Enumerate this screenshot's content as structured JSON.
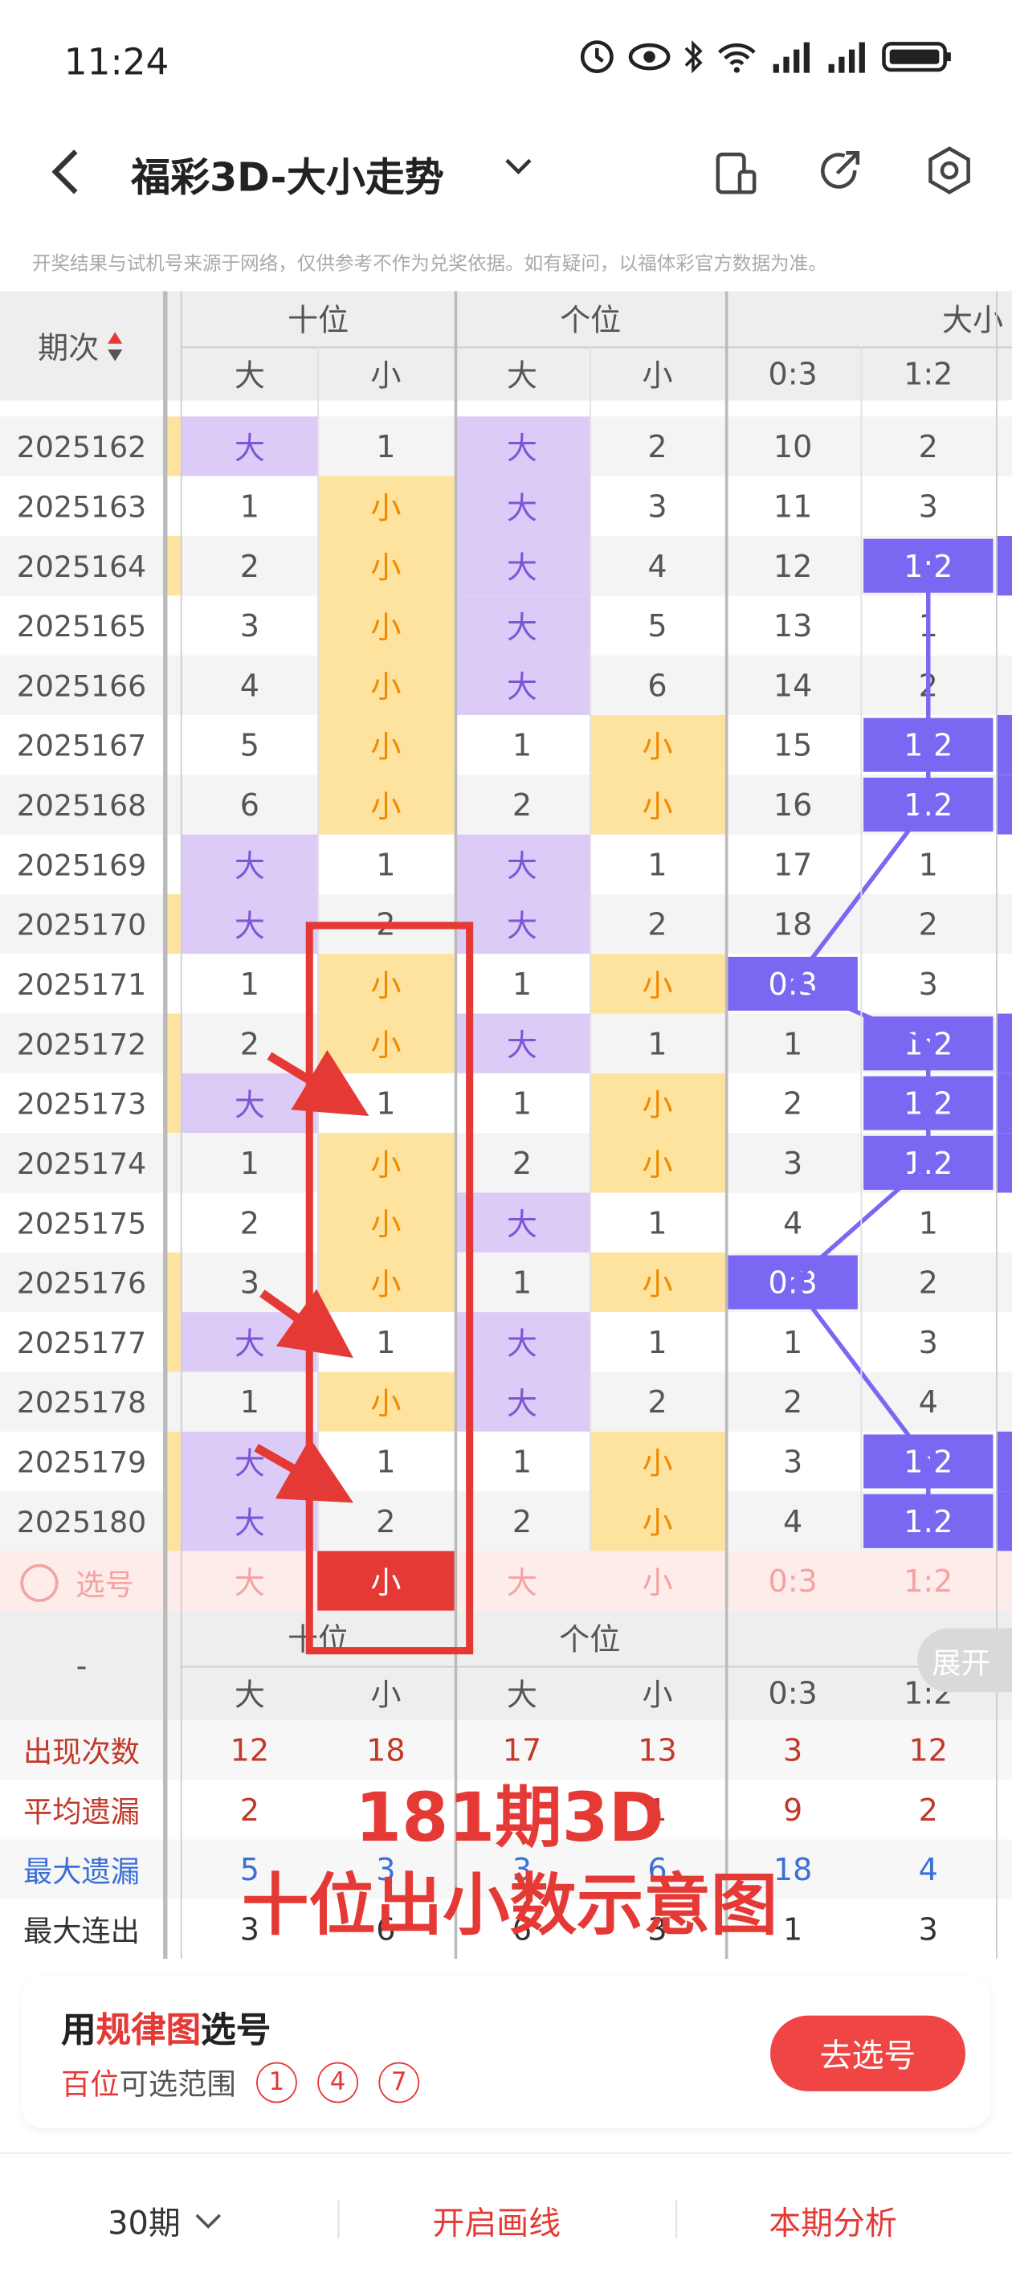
{
  "status": {
    "time": "11:24"
  },
  "header": {
    "title": "福彩3D-大小走势"
  },
  "disclaimer": "开奖结果与试机号来源于网络，仅供参考不作为兑奖依据。如有疑问，以福体彩官方数据为准。",
  "table": {
    "issue_header": "期次",
    "group_headers": [
      "十位",
      "个位",
      "大小"
    ],
    "sub_headers": [
      "大",
      "小",
      "大",
      "小",
      "0:3",
      "1:2"
    ],
    "rows": [
      {
        "issue": "2025162",
        "cells": [
          "大",
          "1",
          "大",
          "2",
          "10",
          "2"
        ],
        "styles": [
          "p",
          "",
          "p",
          "",
          "",
          ""
        ]
      },
      {
        "issue": "2025163",
        "cells": [
          "1",
          "小",
          "大",
          "3",
          "11",
          "3"
        ],
        "styles": [
          "",
          "y",
          "p",
          "",
          "",
          ""
        ]
      },
      {
        "issue": "2025164",
        "cells": [
          "2",
          "小",
          "大",
          "4",
          "12",
          "1:2"
        ],
        "styles": [
          "",
          "y",
          "p",
          "",
          "",
          "b"
        ]
      },
      {
        "issue": "2025165",
        "cells": [
          "3",
          "小",
          "大",
          "5",
          "13",
          "1"
        ],
        "styles": [
          "",
          "y",
          "p",
          "",
          "",
          ""
        ]
      },
      {
        "issue": "2025166",
        "cells": [
          "4",
          "小",
          "大",
          "6",
          "14",
          "2"
        ],
        "styles": [
          "",
          "y",
          "p",
          "",
          "",
          ""
        ]
      },
      {
        "issue": "2025167",
        "cells": [
          "5",
          "小",
          "1",
          "小",
          "15",
          "1:2"
        ],
        "styles": [
          "",
          "y",
          "",
          "y",
          "",
          "b"
        ]
      },
      {
        "issue": "2025168",
        "cells": [
          "6",
          "小",
          "2",
          "小",
          "16",
          "1:2"
        ],
        "styles": [
          "",
          "y",
          "",
          "y",
          "",
          "b"
        ]
      },
      {
        "issue": "2025169",
        "cells": [
          "大",
          "1",
          "大",
          "1",
          "17",
          "1"
        ],
        "styles": [
          "p",
          "",
          "p",
          "",
          "",
          ""
        ]
      },
      {
        "issue": "2025170",
        "cells": [
          "大",
          "2",
          "大",
          "2",
          "18",
          "2"
        ],
        "styles": [
          "p",
          "",
          "p",
          "",
          "",
          ""
        ]
      },
      {
        "issue": "2025171",
        "cells": [
          "1",
          "小",
          "1",
          "小",
          "0:3",
          "3"
        ],
        "styles": [
          "",
          "y",
          "",
          "y",
          "b",
          ""
        ]
      },
      {
        "issue": "2025172",
        "cells": [
          "2",
          "小",
          "大",
          "1",
          "1",
          "1:2"
        ],
        "styles": [
          "",
          "y",
          "p",
          "",
          "",
          "b"
        ]
      },
      {
        "issue": "2025173",
        "cells": [
          "大",
          "1",
          "1",
          "小",
          "2",
          "1:2"
        ],
        "styles": [
          "p",
          "",
          "",
          "y",
          "",
          "b"
        ]
      },
      {
        "issue": "2025174",
        "cells": [
          "1",
          "小",
          "2",
          "小",
          "3",
          "1:2"
        ],
        "styles": [
          "",
          "y",
          "",
          "y",
          "",
          "b"
        ]
      },
      {
        "issue": "2025175",
        "cells": [
          "2",
          "小",
          "大",
          "1",
          "4",
          "1"
        ],
        "styles": [
          "",
          "y",
          "p",
          "",
          "",
          ""
        ]
      },
      {
        "issue": "2025176",
        "cells": [
          "3",
          "小",
          "1",
          "小",
          "0:3",
          "2"
        ],
        "styles": [
          "",
          "y",
          "",
          "y",
          "b",
          ""
        ]
      },
      {
        "issue": "2025177",
        "cells": [
          "大",
          "1",
          "大",
          "1",
          "1",
          "3"
        ],
        "styles": [
          "p",
          "",
          "p",
          "",
          "",
          ""
        ]
      },
      {
        "issue": "2025178",
        "cells": [
          "1",
          "小",
          "大",
          "2",
          "2",
          "4"
        ],
        "styles": [
          "",
          "y",
          "p",
          "",
          "",
          ""
        ]
      },
      {
        "issue": "2025179",
        "cells": [
          "大",
          "1",
          "1",
          "小",
          "3",
          "1:2"
        ],
        "styles": [
          "p",
          "",
          "",
          "y",
          "",
          "b"
        ]
      },
      {
        "issue": "2025180",
        "cells": [
          "大",
          "2",
          "2",
          "小",
          "4",
          "1:2"
        ],
        "styles": [
          "p",
          "",
          "",
          "y",
          "",
          "b"
        ]
      }
    ],
    "select_row": {
      "label": "选号",
      "cells": [
        "大",
        "小",
        "大",
        "小",
        "0:3",
        "1:2"
      ]
    },
    "footer_group_headers": [
      "十位",
      "个位"
    ],
    "footer_dash": "-",
    "expand_label": "展开",
    "stats": [
      {
        "label": "出现次数",
        "values": [
          "12",
          "18",
          "17",
          "13",
          "3",
          "12"
        ],
        "color": "#c0392b"
      },
      {
        "label": "平均遗漏",
        "values": [
          "2",
          "",
          "",
          "1",
          "9",
          "2"
        ],
        "color": "#c0392b"
      },
      {
        "label": "最大遗漏",
        "values": [
          "5",
          "3",
          "3",
          "6",
          "18",
          "4"
        ],
        "color": "#3b6fd8"
      },
      {
        "label": "最大连出",
        "values": [
          "3",
          "6",
          "6",
          "3",
          "1",
          "3"
        ],
        "color": "#333333"
      }
    ]
  },
  "annotation": {
    "line1": "181期3D",
    "line2": "十位出小数示意图"
  },
  "card": {
    "prefix": "用",
    "highlight": "规律图",
    "suffix": "选号",
    "range_label": "百位",
    "range_text": "可选范围",
    "picks": [
      "1",
      "4",
      "7"
    ],
    "button": "去选号"
  },
  "bottom": {
    "period": "30期",
    "draw": "开启画线",
    "analysis": "本期分析"
  },
  "colors": {
    "purple": "#dccbf6",
    "yellow": "#fde39e",
    "blue": "#7a68f2",
    "red": "#e53935"
  }
}
